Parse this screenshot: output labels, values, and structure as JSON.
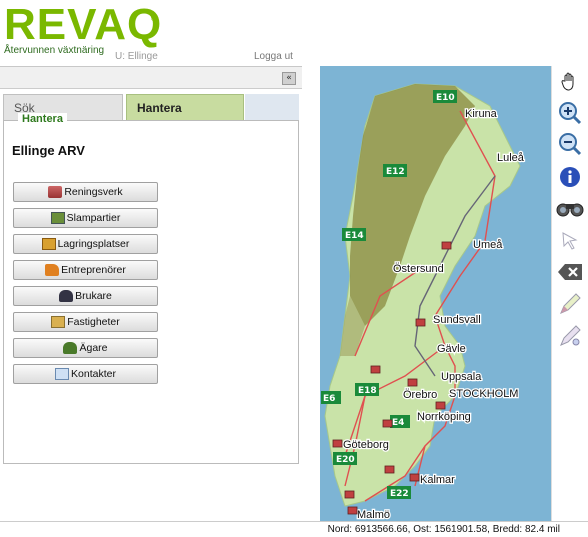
{
  "header": {
    "logo": "REVAQ",
    "tagline": "Återvunnen växtnäring",
    "user": "U: Ellinge",
    "logout": "Logga ut"
  },
  "left_panel": {
    "collapse_glyph": "«",
    "tabs": [
      {
        "label": "Sök",
        "active": false
      },
      {
        "label": "Hantera",
        "active": true
      }
    ],
    "section_legend": "Hantera",
    "title": "Ellinge ARV",
    "buttons": [
      {
        "label": "Reningsverk",
        "icon": "treatment-plant-icon"
      },
      {
        "label": "Slampartier",
        "icon": "sludge-icon"
      },
      {
        "label": "Lagringsplatser",
        "icon": "storage-icon"
      },
      {
        "label": "Entreprenörer",
        "icon": "truck-icon"
      },
      {
        "label": "Brukare",
        "icon": "farmer-icon"
      },
      {
        "label": "Fastigheter",
        "icon": "property-icon"
      },
      {
        "label": "Ägare",
        "icon": "owner-icon"
      },
      {
        "label": "Kontakter",
        "icon": "contacts-icon"
      }
    ]
  },
  "map": {
    "roads": [
      "E10",
      "E12",
      "E14",
      "E6",
      "E18",
      "E4",
      "E20",
      "E22"
    ],
    "cities": [
      "Kiruna",
      "Luleå",
      "Umeå",
      "Östersund",
      "Sundsvall",
      "Gävle",
      "Uppsala",
      "Örebro",
      "STOCKHOLM",
      "Norrköping",
      "Göteborg",
      "Kalmar",
      "Malmö"
    ]
  },
  "toolbar": [
    "pan-hand-icon",
    "zoom-in-icon",
    "zoom-out-icon",
    "info-icon",
    "binoculars-icon",
    "select-arrow-icon",
    "clear-icon",
    "draw-line-icon",
    "measure-icon"
  ],
  "status": "Nord: 6913566.66, Ost: 1561901.58, Bredd: 82.4 mil",
  "colors": {
    "brand_green": "#7ab800",
    "tab_active": "#c8dca0",
    "water": "#7db4d4",
    "land": "#c9e3a8",
    "mountain": "#8a8a40"
  }
}
